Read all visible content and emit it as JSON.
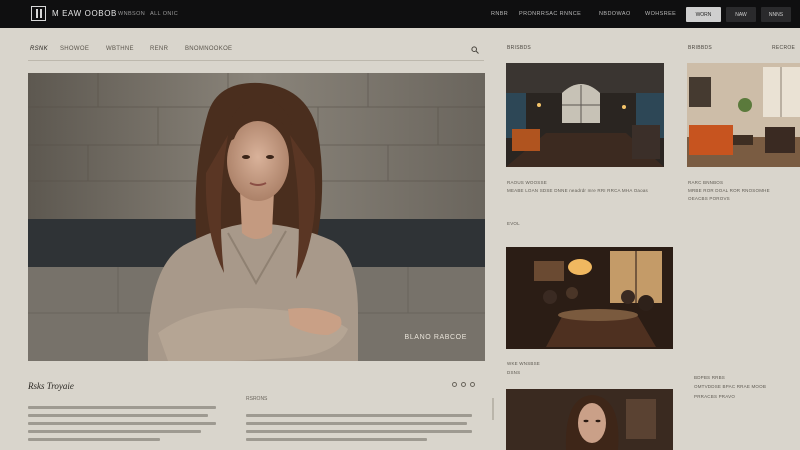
{
  "header": {
    "brand": "M EAW OOBOB",
    "nav_left": [
      "WNBSON",
      "ALL ONIC"
    ],
    "nav_right": [
      "RNBR",
      "PRONRRSAC RNNCE",
      "NBDOWAO",
      "WOHSREE"
    ],
    "buttons": [
      "WORN",
      "NAW",
      "NNNS"
    ]
  },
  "subnav": {
    "items": [
      "RSNK",
      "SHOWOE",
      "WBTHNE",
      "RENR",
      "BNOMNOOKOE"
    ]
  },
  "hero": {
    "caption": "BLANO RABCOE"
  },
  "article": {
    "title": "Rsks Troyaie",
    "col2_head": "RSRONS"
  },
  "sidebar": {
    "col1_head": "BRISBDS",
    "col2_head": "BRIBBDS",
    "col2_head_right": "RECROE",
    "card1_caption": "RAOUS WOOSSE",
    "card1_text": "MEABE LOAN SDSE DNNE neadrdr mre RRI RRCA MHA Oaoas",
    "card1_more": "EVOL",
    "card2_caption": "RARC BNNBOS",
    "card2_text": "MRBE ROR DOAL ROR RNOSOMHE",
    "card2_more": "OEACBS POROVS",
    "card3_caption": "WKE WNSBSE",
    "card3_more": "DSNS",
    "card4_caption": "BDPBS RRBS",
    "card4_text": "OMTVDDSE BPAC RRAE MOOB",
    "card4_more": "PRRACBS PRAVO"
  }
}
